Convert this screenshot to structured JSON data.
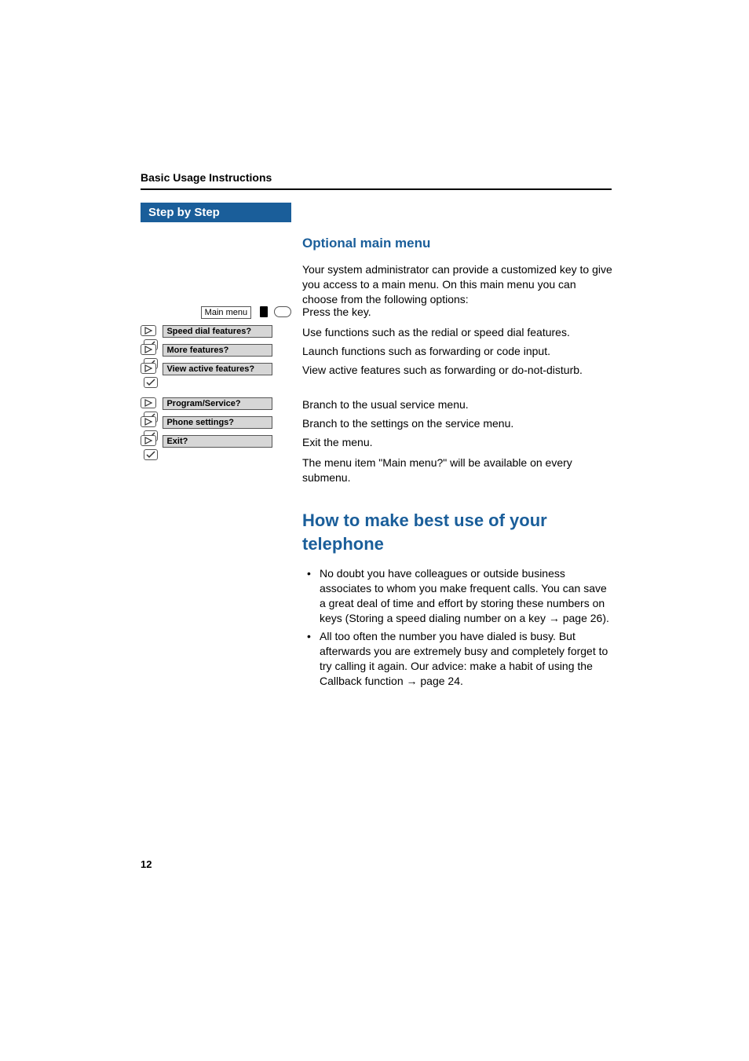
{
  "header": {
    "title": "Basic Usage Instructions"
  },
  "sidebar": {
    "step_title": "Step by Step",
    "main_menu_label": "Main menu",
    "items": [
      {
        "label": "Speed dial features?"
      },
      {
        "label": "More features?"
      },
      {
        "label": "View active features?"
      },
      {
        "label": "Program/Service?"
      },
      {
        "label": "Phone settings?"
      },
      {
        "label": "Exit?"
      }
    ]
  },
  "content": {
    "h3": "Optional main menu",
    "intro": "Your system administrator can provide a customized key to give you access to a main menu. On this main menu you can choose from the following options:",
    "steps": [
      "Press the key.",
      "Use functions such as the redial or speed dial features.",
      "Launch functions such as forwarding or code input.",
      "View active features such as forwarding or do-not-disturb.",
      "Branch to the usual service menu.",
      "Branch to the settings on the service menu.",
      "Exit the menu."
    ],
    "note": "The menu item \"Main menu?\" will be available on every submenu.",
    "h2": "How to make best use of your telephone",
    "bullets": [
      "No doubt you have colleagues or outside business associates to whom you make frequent calls. You can save a great deal of time and effort by storing these numbers on keys (Storing a speed dialing number on a key → page 26).",
      "All too often the number you have dialed is busy. But afterwards you are extremely busy and completely forget to try calling it again. Our advice: make a habit of using the Callback function → page 24."
    ]
  },
  "page_number": "12",
  "icons": {
    "nav": "play-icon",
    "confirm": "check-icon"
  }
}
